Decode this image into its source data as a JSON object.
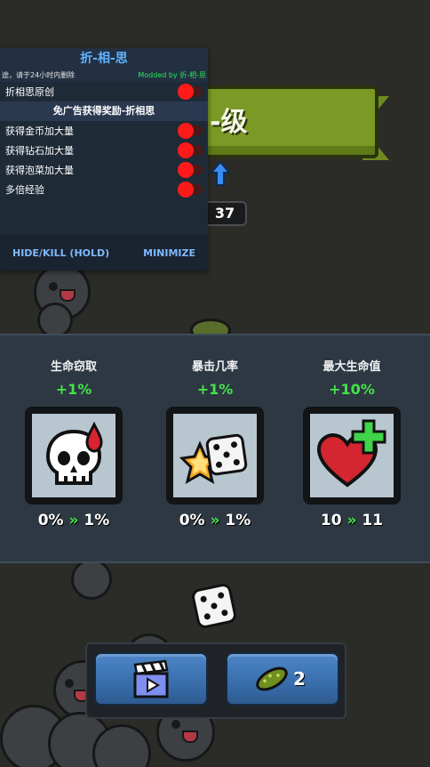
{
  "mod_menu": {
    "title": "折-相-思",
    "subtitle_left": "途，请于24小时内删除",
    "subtitle_right": "Modded by 折-相-思",
    "original_label": "折相思原创",
    "section_header": "免广告获得奖励-折相思",
    "options": [
      {
        "label": "获得金币加大量",
        "enabled": false
      },
      {
        "label": "获得钻石加大量",
        "enabled": false
      },
      {
        "label": "获得泡菜加大量",
        "enabled": false
      },
      {
        "label": "多倍经验",
        "enabled": false
      }
    ],
    "hide_kill_label": "HIDE/KILL (HOLD)",
    "minimize_label": "MINIMIZE",
    "accent_color": "#5fb3ff",
    "toggle_color": "#ff1a1a"
  },
  "game": {
    "banner_text": "-级",
    "level_number": "37"
  },
  "upgrades": [
    {
      "title": "生命窃取",
      "bonus": "+1%",
      "from": "0%",
      "to": "1%",
      "icon": "skull-blood-icon"
    },
    {
      "title": "暴击几率",
      "bonus": "+1%",
      "from": "0%",
      "to": "1%",
      "icon": "dice-star-icon"
    },
    {
      "title": "最大生命值",
      "bonus": "+10%",
      "from": "10",
      "to": "11",
      "icon": "heart-plus-icon"
    }
  ],
  "arrow_glyph": "»",
  "bottom_bar": {
    "ad_button_icon": "video-clapper-icon",
    "pickle_button_icon": "pickle-icon",
    "pickle_count": "2"
  }
}
